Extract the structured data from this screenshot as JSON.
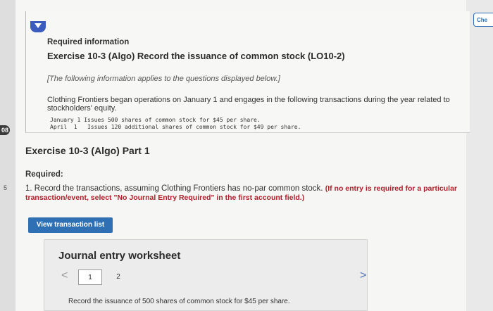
{
  "side": {
    "numbers": [
      "08",
      "5"
    ],
    "check_label": "Che"
  },
  "info": {
    "required_information": "Required information",
    "exercise_title": "Exercise 10-3 (Algo) Record the issuance of common stock (LO10-2)",
    "note": "[The following information applies to the questions displayed below.]",
    "description": "Clothing Frontiers began operations on January 1 and engages in the following transactions during the year related to stockholders' equity.",
    "transactions": [
      {
        "date": "January 1",
        "text": "Issues 500 shares of common stock for $45 per share."
      },
      {
        "date": "April  1",
        "text": "Issues 120 additional shares of common stock for $49 per share."
      }
    ]
  },
  "part": {
    "title": "Exercise 10-3 (Algo) Part 1",
    "required_label": "Required:",
    "required_text": "1. Record the transactions, assuming Clothing Frontiers has no-par common stock.",
    "required_note": "(If no entry is required for a particular transaction/event, select \"No Journal Entry Required\" in the first account field.)"
  },
  "buttons": {
    "view_transaction_list": "View transaction list"
  },
  "worksheet": {
    "title": "Journal entry worksheet",
    "prev_symbol": "<",
    "next_symbol": ">",
    "steps": [
      "1",
      "2"
    ],
    "instruction": "Record the issuance of 500 shares of common stock for $45 per share."
  },
  "colors": {
    "accent": "#2f6fb3",
    "tab": "#3b5bbf",
    "required_note": "#b0202a"
  }
}
